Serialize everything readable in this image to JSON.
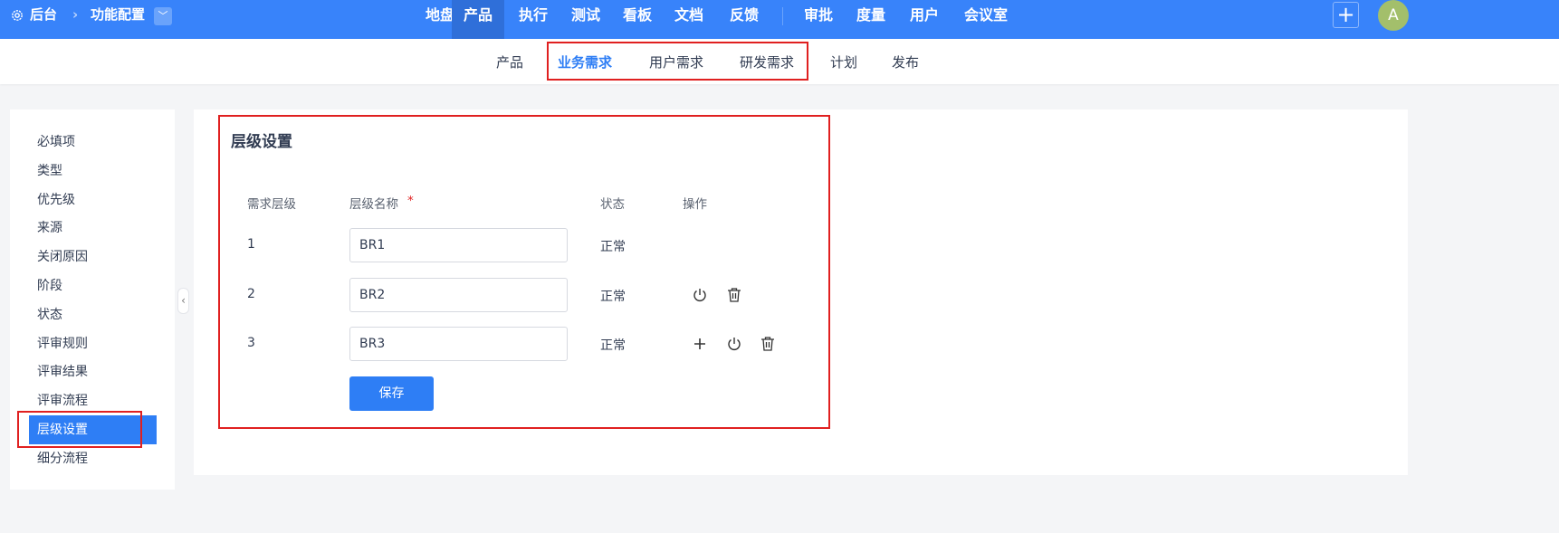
{
  "topbar": {
    "breadcrumb_root": "后台",
    "breadcrumb_current": "功能配置",
    "nav": [
      "地盘",
      "产品",
      "执行",
      "测试",
      "看板",
      "文档",
      "反馈",
      "审批",
      "度量",
      "用户",
      "会议室"
    ],
    "active_nav": "产品",
    "avatar": "A"
  },
  "subnav": {
    "items": [
      "产品",
      "业务需求",
      "用户需求",
      "研发需求",
      "计划",
      "发布"
    ],
    "active": "业务需求"
  },
  "sidebar": {
    "items": [
      "必填项",
      "类型",
      "优先级",
      "来源",
      "关闭原因",
      "阶段",
      "状态",
      "评审规则",
      "评审结果",
      "评审流程",
      "层级设置",
      "细分流程"
    ],
    "active": "层级设置"
  },
  "main": {
    "title": "层级设置",
    "headers": {
      "level": "需求层级",
      "name": "层级名称",
      "required": "*",
      "status": "状态",
      "actions": "操作"
    },
    "rows": [
      {
        "level": "1",
        "name": "BR1",
        "status": "正常"
      },
      {
        "level": "2",
        "name": "BR2",
        "status": "正常"
      },
      {
        "level": "3",
        "name": "BR3",
        "status": "正常"
      }
    ],
    "save_label": "保存"
  },
  "colors": {
    "primary": "#3883fa",
    "accent": "#2e7ef5",
    "highlight": "#e02020"
  }
}
